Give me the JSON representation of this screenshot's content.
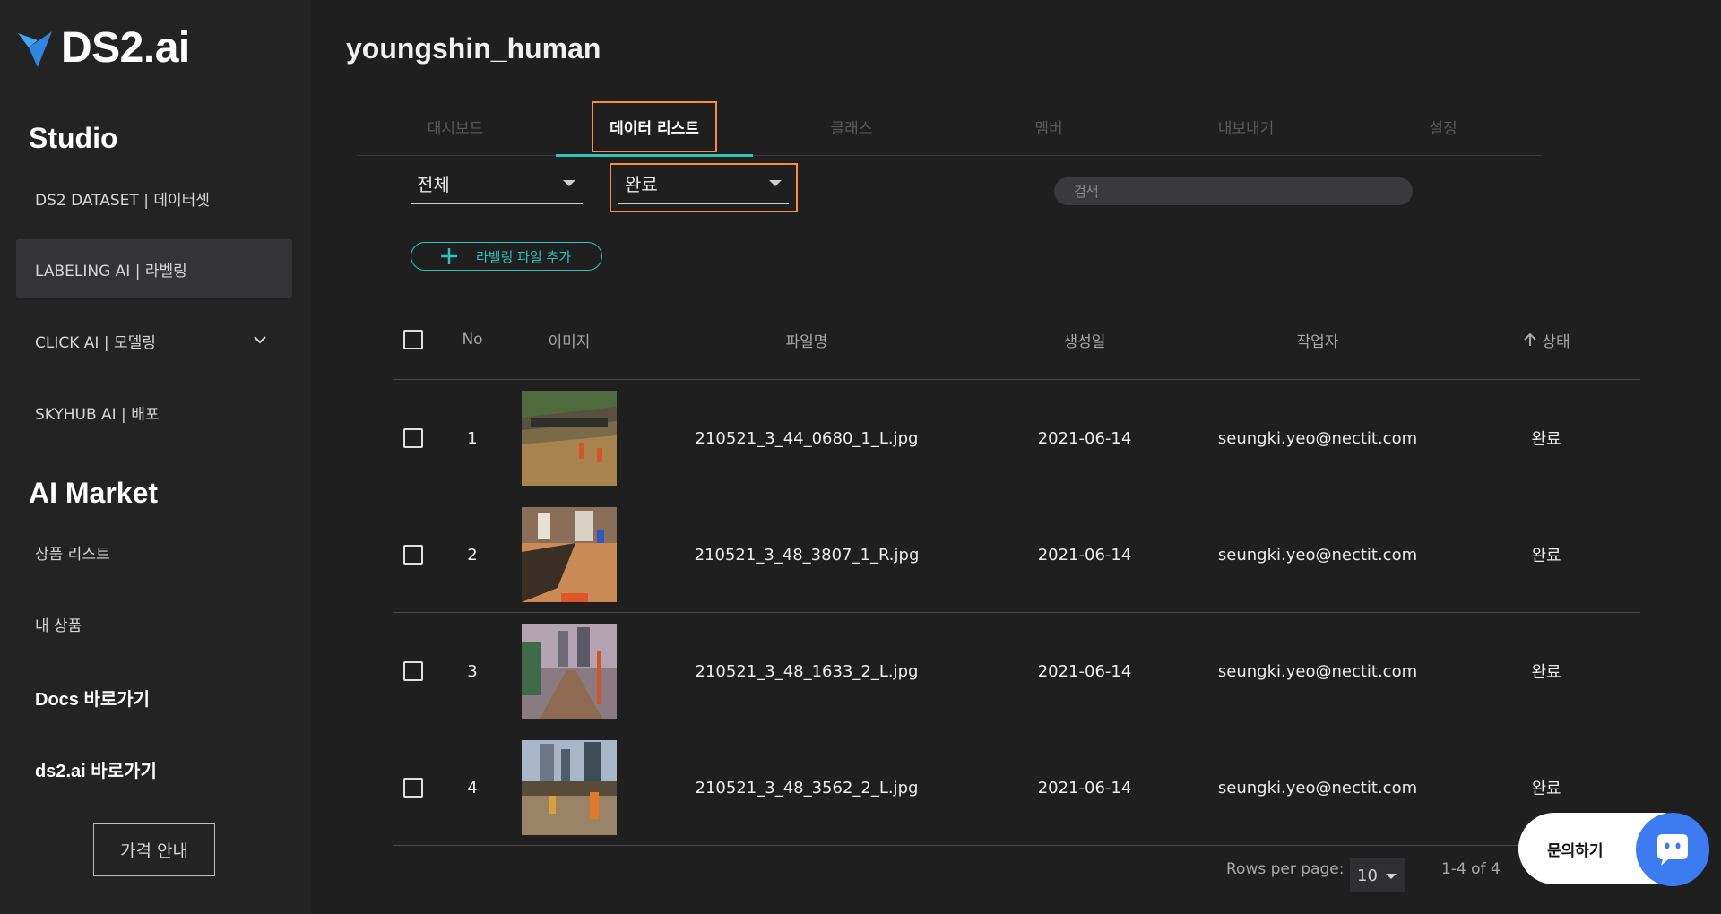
{
  "sidebar": {
    "logo": "DS2.ai",
    "studio_title": "Studio",
    "studio_items": [
      {
        "label": "DS2 DATASET | 데이터셋"
      },
      {
        "label": "LABELING AI | 라벨링"
      },
      {
        "label": "CLICK AI | 모델링"
      },
      {
        "label": "SKYHUB AI | 배포"
      }
    ],
    "market_title": "AI Market",
    "market_items": [
      {
        "label": "상품 리스트"
      },
      {
        "label": "내 상품"
      }
    ],
    "links": [
      {
        "label": "Docs 바로가기"
      },
      {
        "label": "ds2.ai 바로가기"
      }
    ],
    "price_button": "가격 안내"
  },
  "page": {
    "title": "youngshin_human"
  },
  "tabs": [
    {
      "label": "대시보드"
    },
    {
      "label": "데이터 리스트"
    },
    {
      "label": "클래스"
    },
    {
      "label": "멤버"
    },
    {
      "label": "내보내기"
    },
    {
      "label": "설정"
    }
  ],
  "filters": {
    "type_value": "전체",
    "status_value": "완료",
    "search_placeholder": "검색"
  },
  "add_button": "라벨링 파일 추가",
  "table": {
    "headers": {
      "no": "No",
      "image": "이미지",
      "filename": "파일명",
      "created": "생성일",
      "worker": "작업자",
      "status": "상태"
    },
    "rows": [
      {
        "no": "1",
        "filename": "210521_3_44_0680_1_L.jpg",
        "created": "2021-06-14",
        "worker": "seungki.yeo@nectit.com",
        "status": "완료"
      },
      {
        "no": "2",
        "filename": "210521_3_48_3807_1_R.jpg",
        "created": "2021-06-14",
        "worker": "seungki.yeo@nectit.com",
        "status": "완료"
      },
      {
        "no": "3",
        "filename": "210521_3_48_1633_2_L.jpg",
        "created": "2021-06-14",
        "worker": "seungki.yeo@nectit.com",
        "status": "완료"
      },
      {
        "no": "4",
        "filename": "210521_3_48_3562_2_L.jpg",
        "created": "2021-06-14",
        "worker": "seungki.yeo@nectit.com",
        "status": "완료"
      }
    ]
  },
  "pagination": {
    "rows_label": "Rows per page:",
    "rows_value": "10",
    "range": "1-4 of 4"
  },
  "chat": {
    "label": "문의하기"
  },
  "colors": {
    "accent": "#2ec4b6",
    "highlight": "#ff8a3d",
    "chat": "#3d7bf2"
  }
}
